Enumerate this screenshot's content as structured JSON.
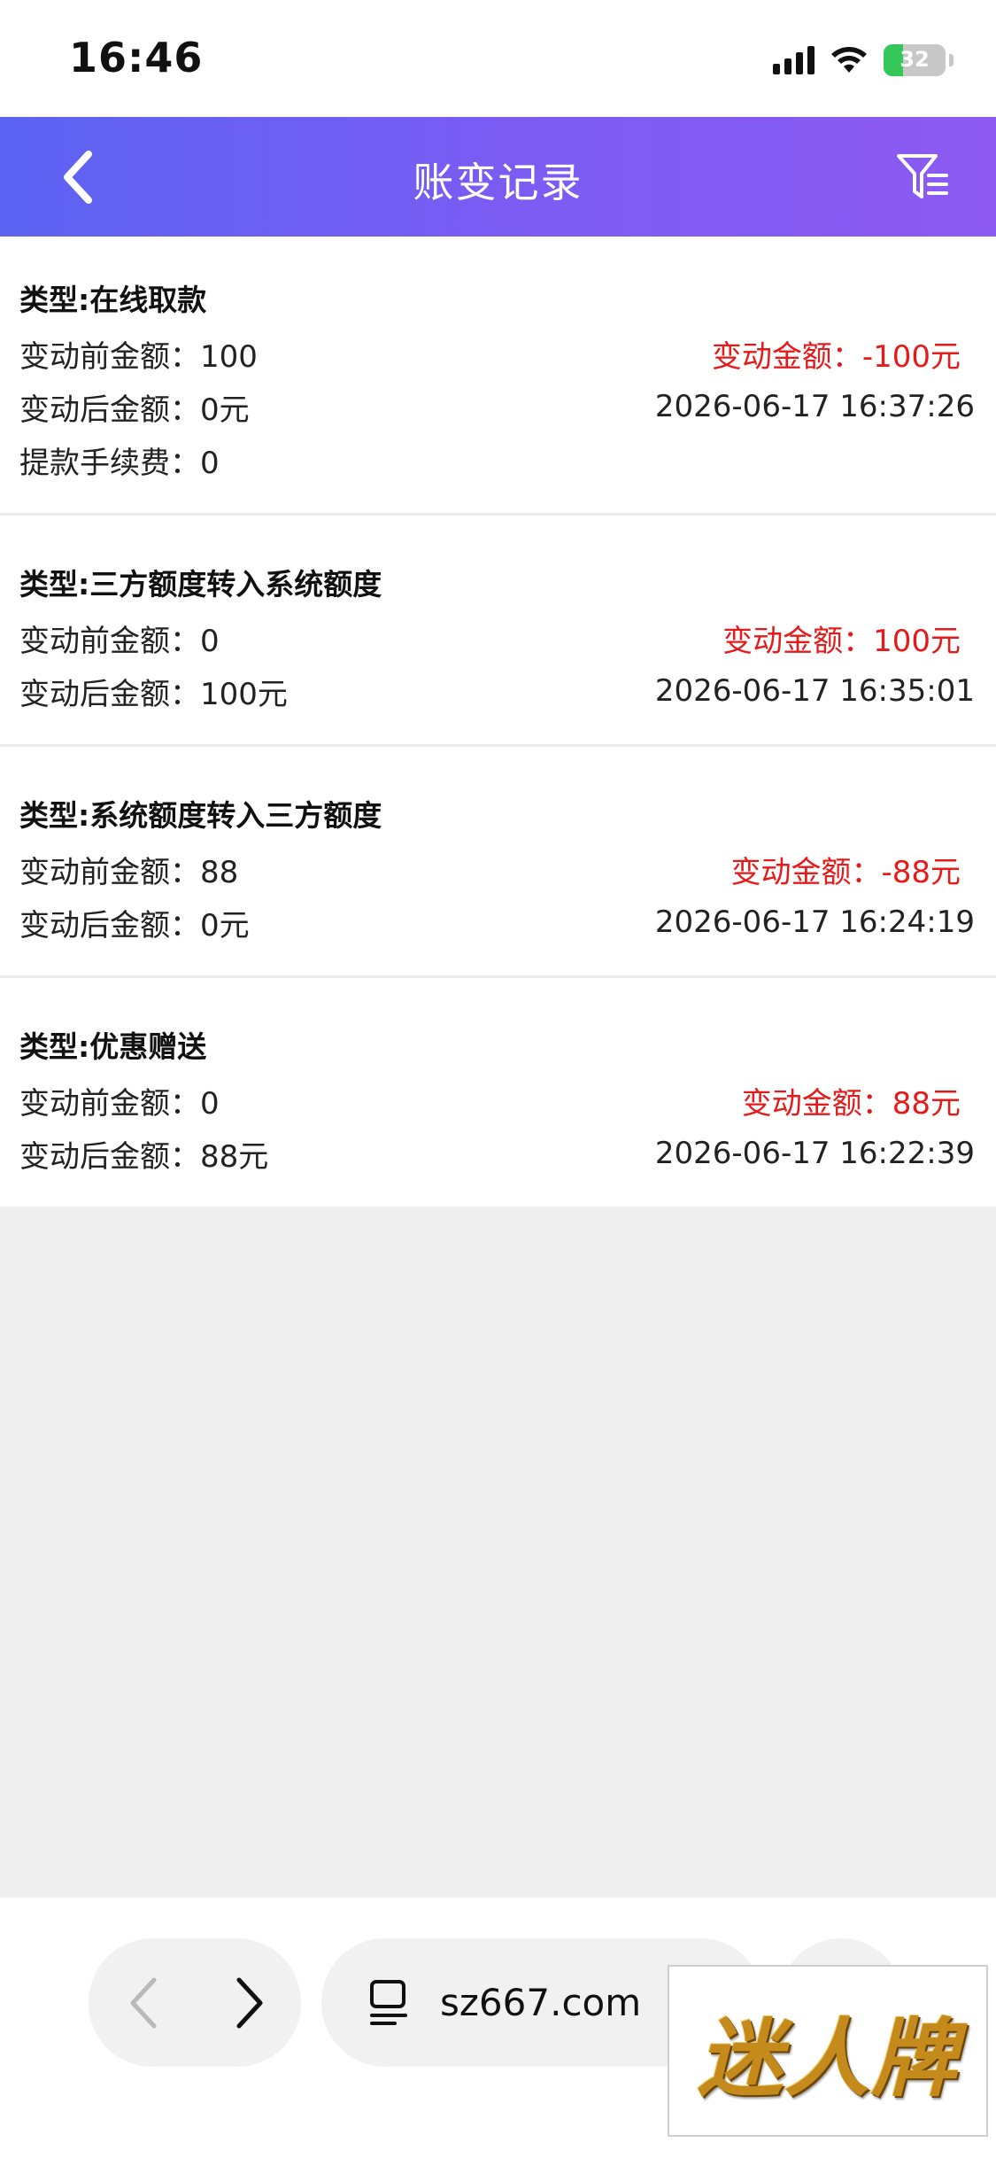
{
  "status_bar": {
    "time": "16:46",
    "battery_text": "32",
    "battery_level": 0.32,
    "accent_battery": "#35c759"
  },
  "header": {
    "title": "账变记录",
    "back_icon": "chevron-left-icon",
    "filter_icon": "filter-icon",
    "gradient": [
      "#5b63f2",
      "#8c5af2"
    ]
  },
  "records": [
    {
      "type": "类型:在线取款",
      "before": "变动前金额：100",
      "change": "变动金额：-100元",
      "after": "变动后金额：0元",
      "time": "2026-06-17 16:37:26",
      "fee": "提款手续费：0"
    },
    {
      "type": "类型:三方额度转入系统额度",
      "before": "变动前金额：0",
      "change": "变动金额：100元",
      "after": "变动后金额：100元",
      "time": "2026-06-17 16:35:01"
    },
    {
      "type": "类型:系统额度转入三方额度",
      "before": "变动前金额：88",
      "change": "变动金额：-88元",
      "after": "变动后金额：0元",
      "time": "2026-06-17 16:24:19"
    },
    {
      "type": "类型:优惠赠送",
      "before": "变动前金额：0",
      "change": "变动金额：88元",
      "after": "变动后金额：88元",
      "time": "2026-06-17 16:22:39"
    }
  ],
  "browser": {
    "url": "sz667.com",
    "back_icon": "browser-back-icon",
    "forward_icon": "browser-forward-icon",
    "tabs_icon": "tabs-icon"
  },
  "watermark": {
    "text": "迷人牌"
  },
  "colors": {
    "change_amount": "#e51b1b",
    "page_background": "#efefef"
  }
}
